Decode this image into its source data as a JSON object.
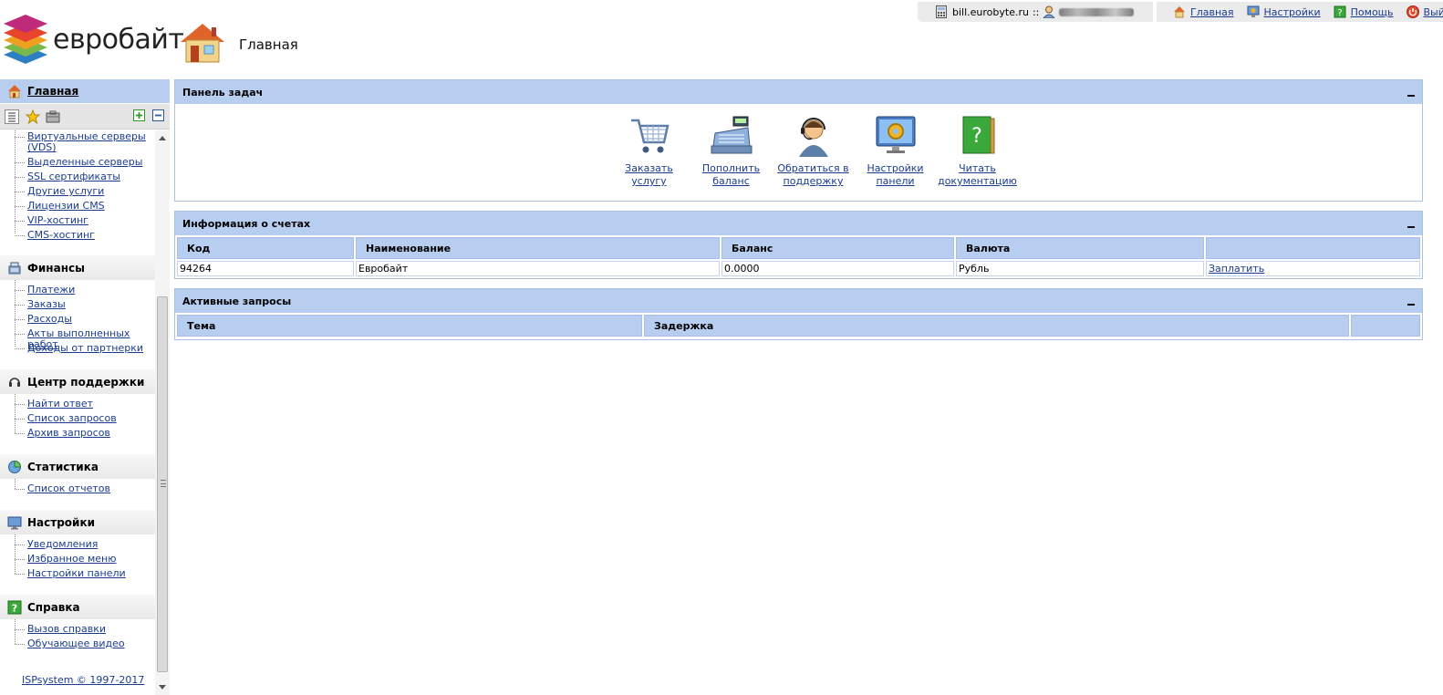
{
  "brand": {
    "name": "евробайт"
  },
  "header": {
    "title": "Главная"
  },
  "topbar": {
    "host": "bill.eurobyte.ru",
    "sep": "::",
    "nav": [
      {
        "label": "Главная",
        "icon": "home-icon"
      },
      {
        "label": "Настройки",
        "icon": "settings-icon"
      },
      {
        "label": "Помощь",
        "icon": "help-icon"
      },
      {
        "label": "Выйти",
        "icon": "logout-icon"
      }
    ]
  },
  "sidebar": {
    "home_label": "Главная",
    "items_top": [
      "Виртуальные серверы (VDS)",
      "Выделенные серверы",
      "SSL сертификаты",
      "Другие услуги",
      "Лицензии CMS",
      "VIP-хостинг",
      "CMS-хостинг"
    ],
    "groups": [
      {
        "title": "Финансы",
        "icon": "finance-icon",
        "items": [
          "Платежи",
          "Заказы",
          "Расходы",
          "Акты выполненных работ",
          "Доходы от партнерки"
        ]
      },
      {
        "title": "Центр поддержки",
        "icon": "headset-icon",
        "items": [
          "Найти ответ",
          "Список запросов",
          "Архив запросов"
        ]
      },
      {
        "title": "Статистика",
        "icon": "pie-chart-icon",
        "items": [
          "Список отчетов"
        ]
      },
      {
        "title": "Настройки",
        "icon": "monitor-icon",
        "items": [
          "Уведомления",
          "Избранное меню",
          "Настройки панели"
        ]
      },
      {
        "title": "Справка",
        "icon": "help-book-icon",
        "items": [
          "Вызов справки",
          "Обучающее видео"
        ]
      }
    ],
    "copyright": "ISPsystem © 1997-2017"
  },
  "tasks_panel": {
    "title": "Панель задач",
    "tasks": [
      {
        "label": "Заказать услугу",
        "icon": "cart-icon"
      },
      {
        "label": "Пополнить баланс",
        "icon": "cash-register-icon"
      },
      {
        "label": "Обратиться в поддержку",
        "icon": "support-agent-icon"
      },
      {
        "label": "Настройки панели",
        "icon": "panel-settings-icon"
      },
      {
        "label": "Читать документацию",
        "icon": "documentation-icon"
      }
    ]
  },
  "accounts_panel": {
    "title": "Информация о счетах",
    "columns": [
      "Код",
      "Наименование",
      "Баланс",
      "Валюта",
      ""
    ],
    "rows": [
      {
        "code": "94264",
        "name": "Евробайт",
        "balance": "0.0000",
        "currency": "Рубль",
        "action": "Заплатить"
      }
    ]
  },
  "requests_panel": {
    "title": "Активные запросы",
    "columns": [
      "Тема",
      "Задержка",
      ""
    ]
  },
  "colors": {
    "header_blue": "#b8cef0",
    "link": "#1a3c8f",
    "panel_border": "#aac0e4"
  }
}
